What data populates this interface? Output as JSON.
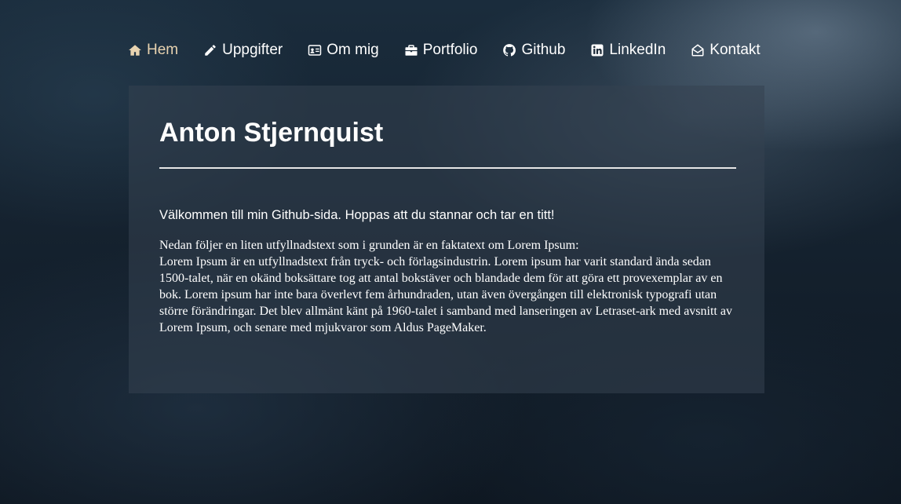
{
  "nav": {
    "items": [
      {
        "label": "Hem",
        "icon": "home-icon"
      },
      {
        "label": "Uppgifter",
        "icon": "pencil-icon"
      },
      {
        "label": "Om mig",
        "icon": "id-card-icon"
      },
      {
        "label": "Portfolio",
        "icon": "briefcase-icon"
      },
      {
        "label": "Github",
        "icon": "github-icon"
      },
      {
        "label": "LinkedIn",
        "icon": "linkedin-icon"
      },
      {
        "label": "Kontakt",
        "icon": "envelope-open-icon"
      }
    ],
    "active": "Hem"
  },
  "colors": {
    "active_nav": "#e8d3b0",
    "text": "#ffffff"
  },
  "main": {
    "title": "Anton Stjernquist",
    "welcome": "Välkommen till min Github-sida. Hoppas att du stannar och tar en titt!",
    "intro": "Nedan följer en liten utfyllnadstext som i grunden är en faktatext om Lorem Ipsum:",
    "body": "Lorem Ipsum är en utfyllnadstext från tryck- och förlagsindustrin. Lorem ipsum har varit standard ända sedan 1500-talet, när en okänd boksättare tog att antal bokstäver och blandade dem för att göra ett provexemplar av en bok. Lorem ipsum har inte bara överlevt fem århundraden, utan även övergången till elektronisk typografi utan större förändringar. Det blev allmänt känt på 1960-talet i samband med lanseringen av Letraset-ark med avsnitt av Lorem Ipsum, och senare med mjukvaror som Aldus PageMaker."
  }
}
